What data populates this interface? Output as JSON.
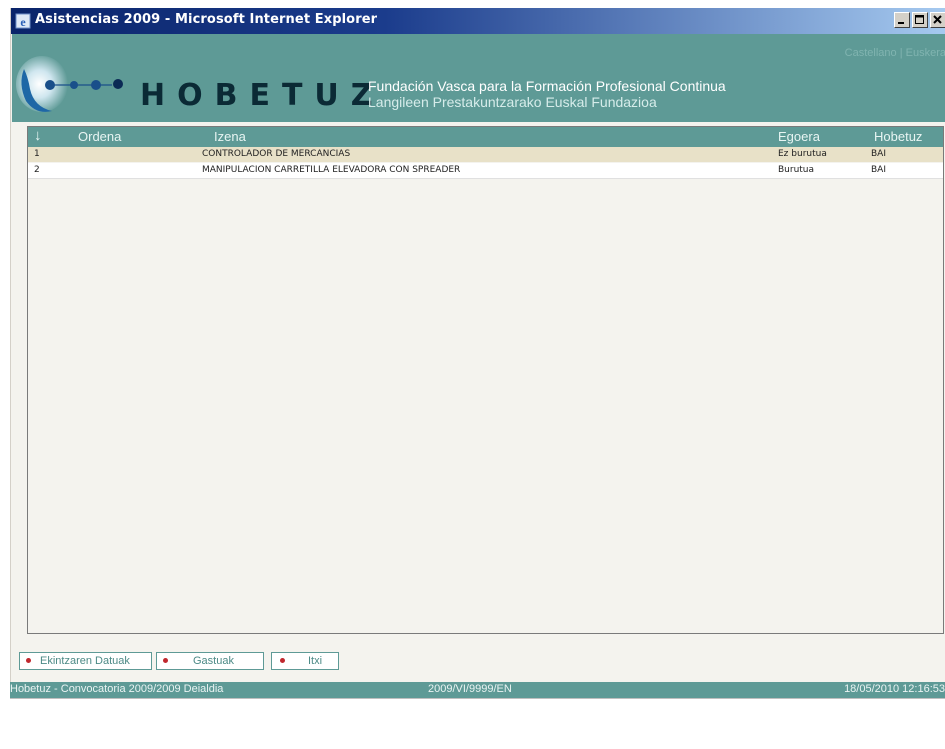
{
  "window": {
    "title": "Asistencias 2009 - Microsoft Internet Explorer"
  },
  "banner": {
    "lang_castellano": "Castellano",
    "lang_sep": " | ",
    "lang_euskera": "Euskera",
    "brand": "HOBETUZ",
    "subtitle_es": "Fundación Vasca para la Formación Profesional Continua",
    "subtitle_eu": "Langileen Prestakuntzarako Euskal Fundazioa"
  },
  "table": {
    "sort_icon": "↓",
    "columns": [
      "Ordena",
      "Izena",
      "Egoera",
      "Hobetuz"
    ],
    "rows": [
      {
        "ordena": "1",
        "izena": "CONTROLADOR DE MERCANCIAS",
        "egoera": "Ez burutua",
        "hobetuz": "BAI"
      },
      {
        "ordena": "2",
        "izena": "MANIPULACION CARRETILLA ELEVADORA CON SPREADER",
        "egoera": "Burutua",
        "hobetuz": "BAI"
      }
    ]
  },
  "buttons": {
    "ekintzaren": "Ekintzaren Datuak",
    "gastuak": "Gastuak",
    "itxi": "Itxi"
  },
  "status": {
    "left": "Hobetuz - Convocatoria 2009/2009 Deialdia",
    "center": "2009/VI/9999/EN",
    "right": "18/05/2010 12:16:53"
  },
  "colors": {
    "teal": "#5e9a96",
    "selected_row": "#e8e1c8",
    "titlebar": "#0a246a"
  },
  "icons": [
    "ie-icon",
    "minimize-icon",
    "maximize-icon",
    "close-icon",
    "hobetuz-logo",
    "sort-down-icon",
    "bullet-icon"
  ]
}
